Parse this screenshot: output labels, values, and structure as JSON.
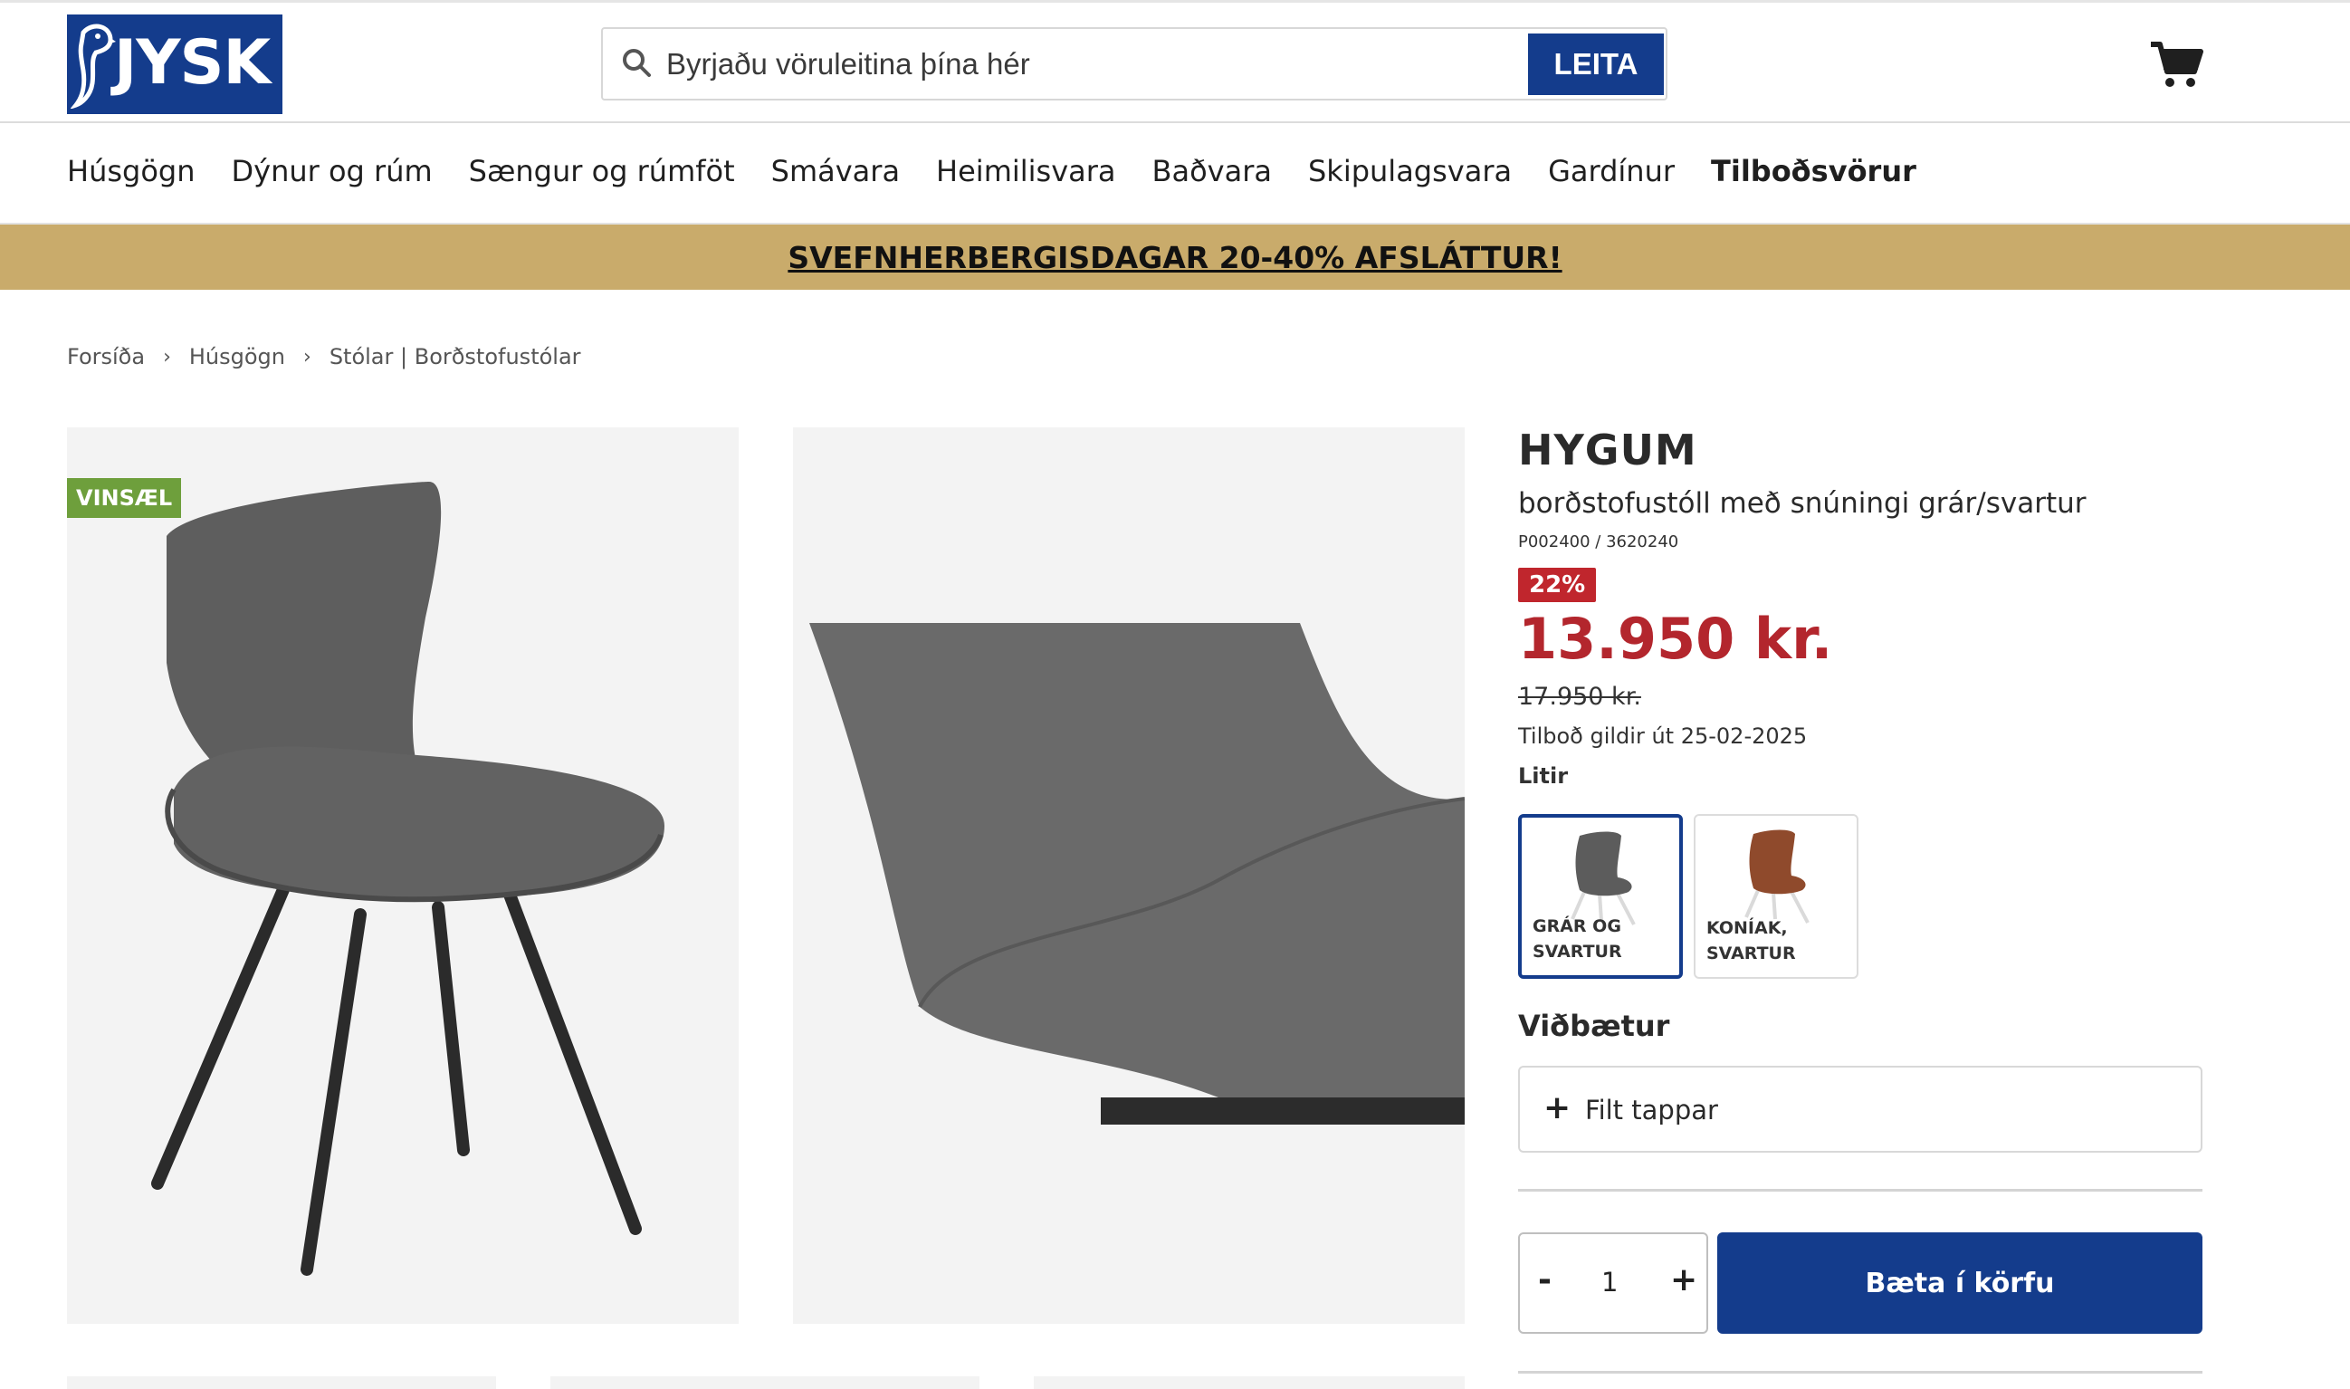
{
  "header": {
    "logo_text": "JYSK",
    "search_placeholder": "Byrjaðu vöruleitina þína hér",
    "search_button": "LEITA"
  },
  "nav": {
    "items": [
      "Húsgögn",
      "Dýnur og rúm",
      "Sængur og rúmföt",
      "Smávara",
      "Heimilisvara",
      "Baðvara",
      "Skipulagsvara",
      "Gardínur",
      "Tilboðsvörur"
    ]
  },
  "banner": {
    "text": "SVEFNHERBERGISDAGAR 20-40% AFSLÁTTUR!"
  },
  "breadcrumb": [
    "Forsíða",
    "Húsgögn",
    "Stólar | Borðstofustólar"
  ],
  "gallery": {
    "badge": "VINSÆL"
  },
  "product": {
    "brand": "HYGUM",
    "name": "borðstofustóll með snúningi grár/svartur",
    "sku": "P002400 / 3620240",
    "discount": "22%",
    "price": "13.950 kr.",
    "old_price": "17.950 kr.",
    "valid_until": "Tilboð gildir út 25-02-2025",
    "colors_label": "Litir",
    "colors": [
      {
        "label": "GRÁR OG SVARTUR",
        "selected": true
      },
      {
        "label": "KONÍAK, SVARTUR",
        "selected": false
      }
    ],
    "addons_title": "Viðbætur",
    "addon": "Filt tappar",
    "quantity": "1",
    "qty_minus": "-",
    "qty_plus": "+",
    "add_to_cart": "Bæta í körfu"
  },
  "colors": {
    "brand_blue": "#143c8c",
    "price_red": "#b3262d",
    "banner_gold": "#c9ab6b",
    "badge_green": "#6e9f3c"
  }
}
